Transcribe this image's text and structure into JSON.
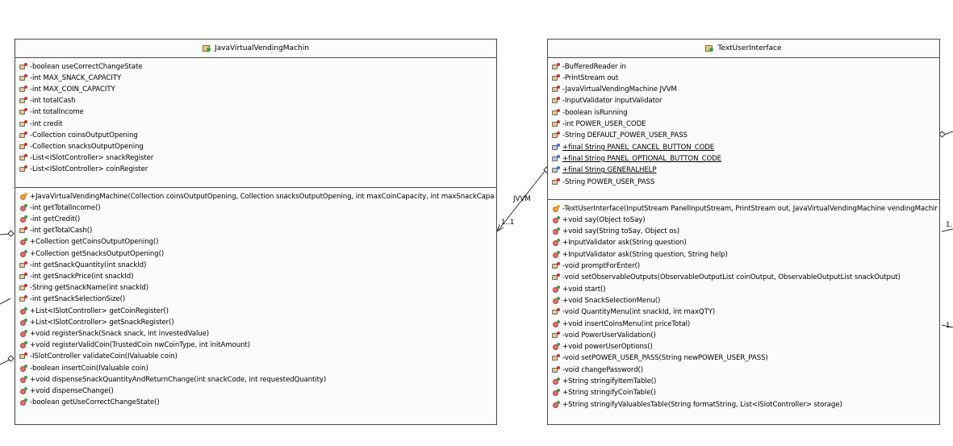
{
  "left_class": {
    "name": "JavaVirtualVendingMachin",
    "attributes": [
      {
        "text": "-boolean useCorrectChangeState",
        "icon": "private-field-icon"
      },
      {
        "text": "-int MAX_SNACK_CAPACITY",
        "icon": "private-field-icon"
      },
      {
        "text": "-int MAX_COIN_CAPACITY",
        "icon": "private-field-icon"
      },
      {
        "text": "-int totalCash",
        "icon": "private-field-icon"
      },
      {
        "text": "-int totalIncome",
        "icon": "private-field-icon"
      },
      {
        "text": "-int credit",
        "icon": "private-field-icon"
      },
      {
        "text": "-Collection coinsOutputOpening",
        "icon": "private-field-icon"
      },
      {
        "text": "-Collection snacksOutputOpening",
        "icon": "private-field-icon"
      },
      {
        "text": "-List<ISlotController> snackRegister",
        "icon": "private-field-icon"
      },
      {
        "text": "-List<ISlotController> coinRegister",
        "icon": "private-field-icon"
      }
    ],
    "methods": [
      {
        "text": "+JavaVirtualVendingMachine(Collection coinsOutputOpening, Collection snacksOutputOpening, int maxCoinCapacity, int maxSnackCapac",
        "icon": "constructor-icon"
      },
      {
        "text": "-int getTotalIncome()",
        "icon": "public-method-icon"
      },
      {
        "text": "-int getCredit()",
        "icon": "public-method-icon"
      },
      {
        "text": "-int getTotalCash()",
        "icon": "private-method-icon"
      },
      {
        "text": "+Collection getCoinsOutputOpening()",
        "icon": "public-method-icon"
      },
      {
        "text": "+Collection getSnacksOutputOpening()",
        "icon": "public-method-icon"
      },
      {
        "text": "-int getSnackQuantity(int snackId)",
        "icon": "private-method-icon"
      },
      {
        "text": "-int getSnackPrice(int snackId)",
        "icon": "private-method-icon"
      },
      {
        "text": "-String getSnackName(int snackId)",
        "icon": "private-method-icon"
      },
      {
        "text": "-int getSnackSelectionSize()",
        "icon": "private-method-icon"
      },
      {
        "text": "+List<ISlotController> getCoinRegister()",
        "icon": "public-method-icon"
      },
      {
        "text": "+List<ISlotController> getSnackRegister()",
        "icon": "public-method-icon"
      },
      {
        "text": "+void registerSnack(Snack snack, int investedValue)",
        "icon": "public-method-icon"
      },
      {
        "text": "+void registerValidCoin(TrustedCoin nwCoinType, int initAmount)",
        "icon": "public-method-icon"
      },
      {
        "text": "-ISlotController validateCoin(IValuable coin)",
        "icon": "private-method-icon"
      },
      {
        "text": "-boolean insertCoin(IValuable coin)",
        "icon": "public-method-icon"
      },
      {
        "text": "+void dispenseSnackQuantityAndReturnChange(int snackCode, int requestedQuantity)",
        "icon": "public-method-icon"
      },
      {
        "text": "+void dispenseChange()",
        "icon": "public-method-icon"
      },
      {
        "text": "-boolean getUseCorrectChangeState()",
        "icon": "public-method-icon"
      }
    ]
  },
  "right_class": {
    "name": "TextUserInterface",
    "attributes": [
      {
        "text": "-BufferedReader in",
        "icon": "private-field-icon",
        "underline": false
      },
      {
        "text": "-PrintStream out",
        "icon": "private-field-icon",
        "underline": false
      },
      {
        "text": "-JavaVirtualVendingMachine JVVM",
        "icon": "private-field-icon",
        "underline": false
      },
      {
        "text": "-InputValidator inputValidator",
        "icon": "private-field-icon",
        "underline": false
      },
      {
        "text": "-boolean isRunning",
        "icon": "private-field-icon",
        "underline": false
      },
      {
        "text": "-int POWER_USER_CODE",
        "icon": "private-field-icon",
        "underline": false
      },
      {
        "text": "-String DEFAULT_POWER_USER_PASS",
        "icon": "private-field-icon",
        "underline": false
      },
      {
        "text": "+final String PANEL_CANCEL_BUTTON_CODE",
        "icon": "static-field-icon",
        "underline": true
      },
      {
        "text": "+final String PANEL_OPTIONAL_BUTTON_CODE",
        "icon": "static-field-icon",
        "underline": true
      },
      {
        "text": "+final String GENERALHELP",
        "icon": "static-field-icon",
        "underline": true
      },
      {
        "text": "-String POWER_USER_PASS",
        "icon": "private-field-icon",
        "underline": false
      }
    ],
    "methods": [
      {
        "text": "-TextUserInterface(InputStream PanelInputStream, PrintStream out, JavaVirtualVendingMachine vendingMachir",
        "icon": "constructor-icon"
      },
      {
        "text": "+void say(Object toSay)",
        "icon": "public-method-icon"
      },
      {
        "text": "+void say(String toSay, Object os)",
        "icon": "public-method-icon"
      },
      {
        "text": "+InputValidator ask(String question)",
        "icon": "public-method-icon"
      },
      {
        "text": "+InputValidator ask(String question, String help)",
        "icon": "public-method-icon"
      },
      {
        "text": "-void promptForEnter()",
        "icon": "private-method-icon"
      },
      {
        "text": "-void setObservableOutputs(ObservableOutputList coinOutput, ObservableOutputList snackOutput)",
        "icon": "private-method-icon"
      },
      {
        "text": "+void start()",
        "icon": "public-method-icon"
      },
      {
        "text": "+void SnackSelectionMenu()",
        "icon": "public-method-icon"
      },
      {
        "text": "-void QuantityMenu(int snackId, int maxQTY)",
        "icon": "private-method-icon"
      },
      {
        "text": "+void insertCoinsMenu(int priceTotal)",
        "icon": "public-method-icon"
      },
      {
        "text": "-void PowerUserValidation()",
        "icon": "private-method-icon"
      },
      {
        "text": "+void powerUserOptions()",
        "icon": "public-method-icon"
      },
      {
        "text": "-void setPOWER_USER_PASS(String newPOWER_USER_PASS)",
        "icon": "private-method-icon"
      },
      {
        "text": "-void changePassword()",
        "icon": "private-method-icon"
      },
      {
        "text": "+String stringifyItemTable()",
        "icon": "public-method-icon"
      },
      {
        "text": "+String stringifyCoinTable()",
        "icon": "public-method-icon"
      },
      {
        "text": "+String stringifyValuablesTable(String formatString, List<ISlotController> storage)",
        "icon": "public-method-icon"
      }
    ]
  },
  "association": {
    "role": "JVVM",
    "multiplicity": "1..1"
  },
  "edge_labels": {
    "right_upper": "1.",
    "right_lower": "1.."
  }
}
